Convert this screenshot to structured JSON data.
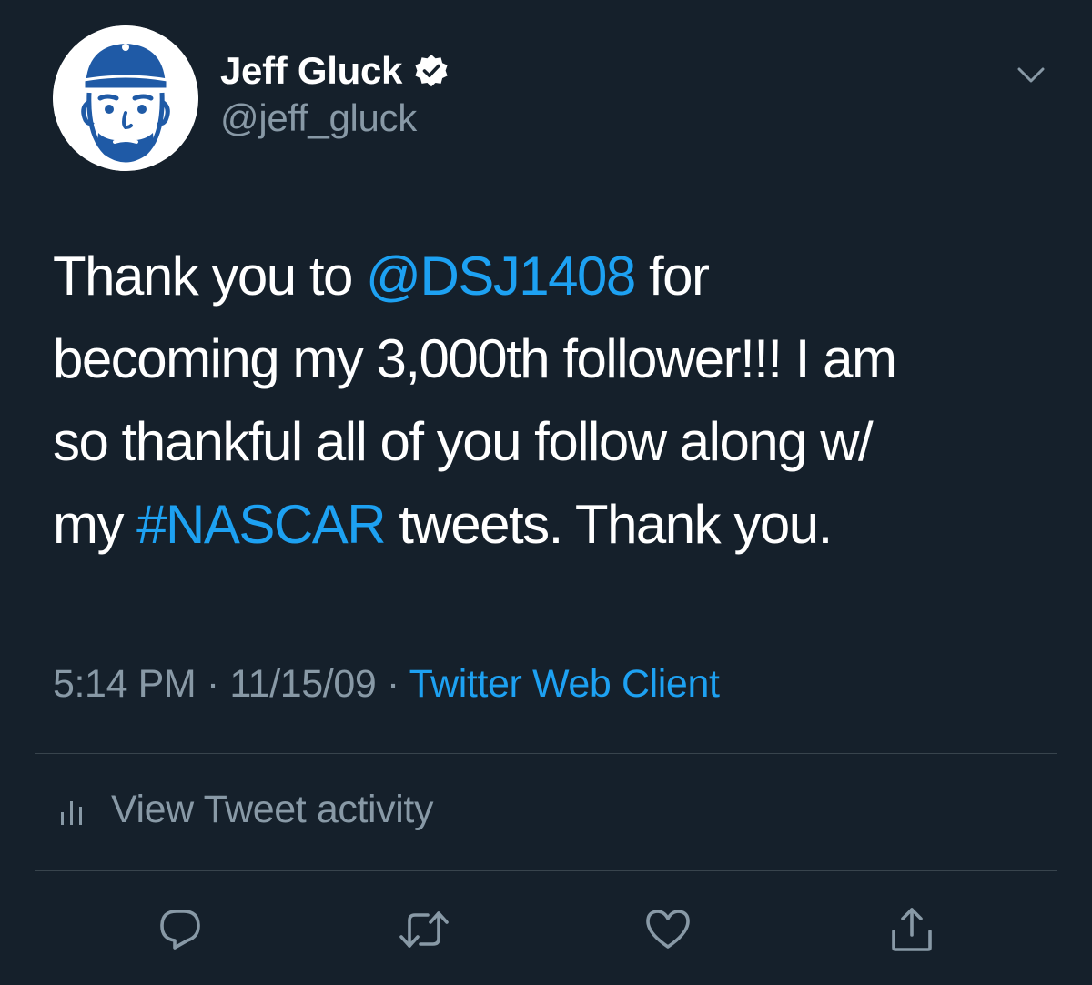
{
  "user": {
    "display_name": "Jeff Gluck",
    "handle": "@jeff_gluck",
    "verified": true,
    "avatar_icon": "cartoon-face-with-cap-avatar"
  },
  "tweet": {
    "lines": [
      [
        {
          "text": "Thank you to ",
          "type": "text"
        },
        {
          "text": "@DSJ1408",
          "type": "mention"
        },
        {
          "text": " for",
          "type": "text"
        }
      ],
      [
        {
          "text": "becoming my 3,000th follower!!! I am",
          "type": "text"
        }
      ],
      [
        {
          "text": "so thankful all of you follow along w/",
          "type": "text"
        }
      ],
      [
        {
          "text": "my ",
          "type": "text"
        },
        {
          "text": "#NASCAR",
          "type": "hashtag"
        },
        {
          "text": " tweets. Thank you.",
          "type": "text"
        }
      ]
    ]
  },
  "meta": {
    "time": "5:14 PM",
    "separator": " · ",
    "date": "11/15/09",
    "source": "Twitter Web Client"
  },
  "activity": {
    "label": "View Tweet activity",
    "icon": "bar-chart-icon"
  },
  "actions": [
    {
      "name": "reply",
      "icon": "reply-icon"
    },
    {
      "name": "retweet",
      "icon": "retweet-icon"
    },
    {
      "name": "like",
      "icon": "like-icon"
    },
    {
      "name": "share",
      "icon": "share-icon"
    }
  ],
  "colors": {
    "background": "#15202b",
    "text_primary": "#ffffff",
    "text_secondary": "#8899a6",
    "link": "#1da1f2",
    "divider": "#38444d",
    "avatar_blue": "#1f5aa6"
  }
}
